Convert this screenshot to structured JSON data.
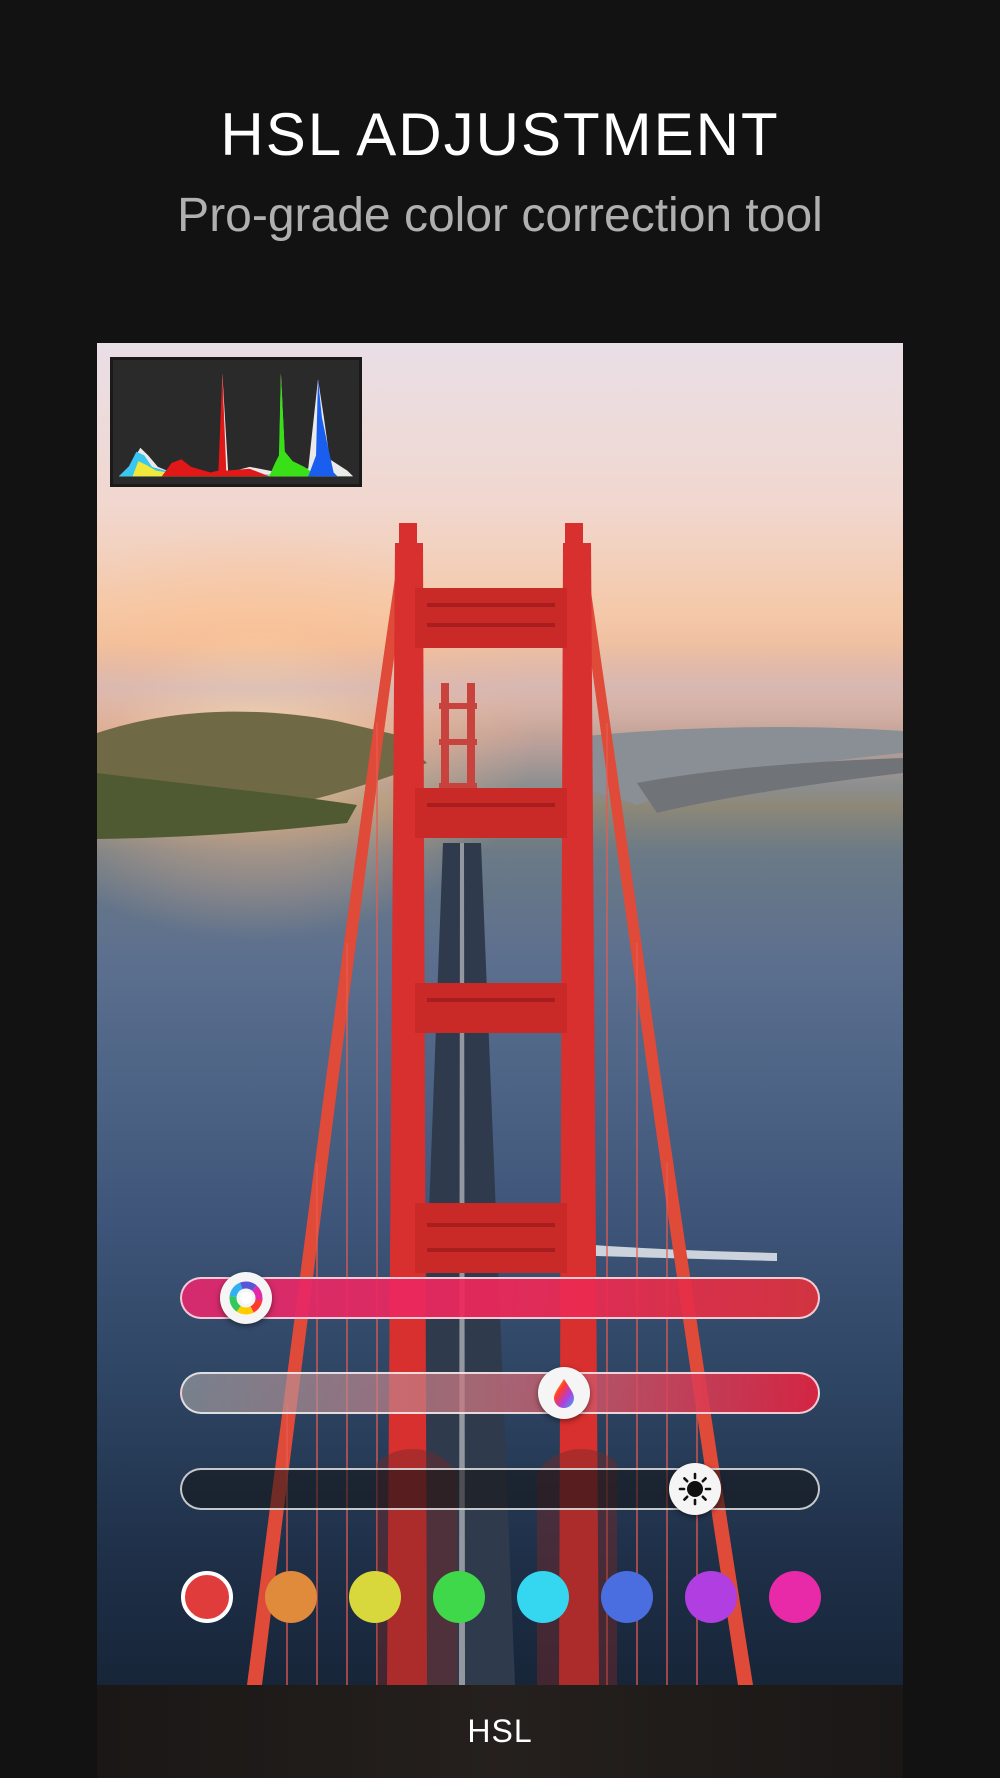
{
  "header": {
    "title": "HSL ADJUSTMENT",
    "subtitle": "Pro-grade color correction tool"
  },
  "sliders": [
    {
      "name": "hue",
      "icon": "color-wheel-icon",
      "value_fraction": 0.05
    },
    {
      "name": "saturation",
      "icon": "color-drop-icon",
      "value_fraction": 0.61
    },
    {
      "name": "luminance",
      "icon": "sun-icon",
      "value_fraction": 0.84
    }
  ],
  "swatches": [
    {
      "color": "#e03c3c",
      "selected": true
    },
    {
      "color": "#e08a3c",
      "selected": false
    },
    {
      "color": "#d8d83c",
      "selected": false
    },
    {
      "color": "#3ed84a",
      "selected": false
    },
    {
      "color": "#34d6f0",
      "selected": false
    },
    {
      "color": "#4a6ee0",
      "selected": false
    },
    {
      "color": "#b03ee0",
      "selected": false
    },
    {
      "color": "#e82aa8",
      "selected": false
    }
  ],
  "bottom_bar": {
    "label": "HSL"
  },
  "colors": {
    "background": "#121212",
    "bridge": "#d8302e"
  }
}
